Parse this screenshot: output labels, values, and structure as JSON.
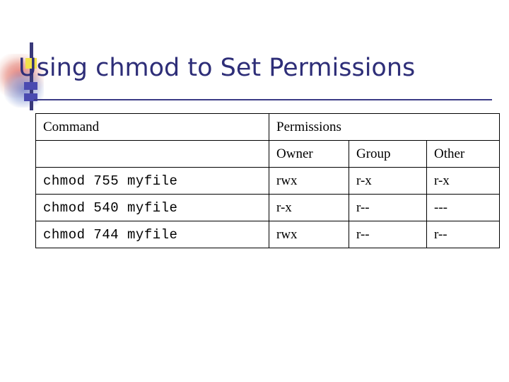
{
  "slide": {
    "title": "Using chmod to Set Permissions"
  },
  "table": {
    "header_command": "Command",
    "header_permissions": "Permissions",
    "subheaders": [
      "Owner",
      "Group",
      "Other"
    ],
    "rows": [
      {
        "command": "chmod 755 myfile",
        "owner": "rwx",
        "group": "r-x",
        "other": "r-x"
      },
      {
        "command": "chmod 540 myfile",
        "owner": "r-x",
        "group": "r--",
        "other": "---"
      },
      {
        "command": "chmod 744 myfile",
        "owner": "rwx",
        "group": "r--",
        "other": "r--"
      }
    ]
  },
  "colors": {
    "title": "#2e2e78",
    "rule": "#3b3b86",
    "accent_yellow": "#f2e24b",
    "accent_blue": "#4a4ab0",
    "accent_red": "#e27670"
  }
}
